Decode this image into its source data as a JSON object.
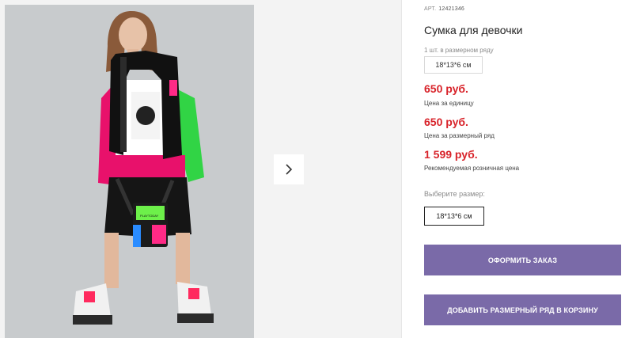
{
  "product": {
    "article_label": "АРТ.",
    "article_number": "12421346",
    "title": "Сумка для девочки",
    "qty_in_row": "1 шт. в размерном ряду",
    "size_chip": "18*13*6 см"
  },
  "prices": [
    {
      "value": "650 руб.",
      "label": "Цена за единицу"
    },
    {
      "value": "650 руб.",
      "label": "Цена за размерный ряд"
    },
    {
      "value": "1 599 руб.",
      "label": "Рекомендуемая розничная цена"
    }
  ],
  "size_picker": {
    "label": "Выберите размер:",
    "selected": "18*13*6 см"
  },
  "buttons": {
    "order": "ОФОРМИТЬ ЗАКАЗ",
    "add_row": "ДОБАВИТЬ РАЗМЕРНЫЙ РЯД В КОРЗИНУ"
  },
  "photo": {
    "bag_text": "PLAYTODAY"
  },
  "colors": {
    "price": "#d8232a",
    "button": "#7a6aa8"
  }
}
